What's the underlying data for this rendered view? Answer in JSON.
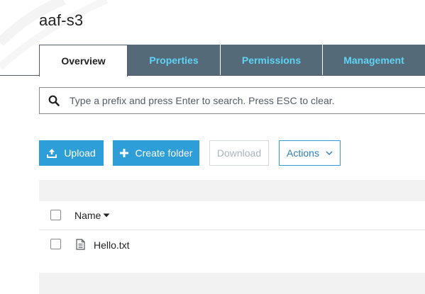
{
  "bucket": {
    "title": "aaf-s3"
  },
  "tabs": [
    {
      "label": "Overview",
      "active": true
    },
    {
      "label": "Properties",
      "active": false
    },
    {
      "label": "Permissions",
      "active": false
    },
    {
      "label": "Management",
      "active": false
    }
  ],
  "search": {
    "placeholder": "Type a prefix and press Enter to search. Press ESC to clear.",
    "value": "",
    "icon": "search-icon"
  },
  "toolbar": {
    "upload_label": "Upload",
    "create_folder_label": "Create folder",
    "download_label": "Download",
    "actions_label": "Actions"
  },
  "table": {
    "columns": [
      {
        "label": "Name",
        "sort": "descending"
      }
    ],
    "rows": [
      {
        "name": "Hello.txt",
        "icon": "file-icon",
        "selected": false
      }
    ]
  },
  "colors": {
    "accent": "#2e9ed9",
    "tab_inactive_bg": "#546a79",
    "tab_inactive_text": "#5fd3f3"
  }
}
